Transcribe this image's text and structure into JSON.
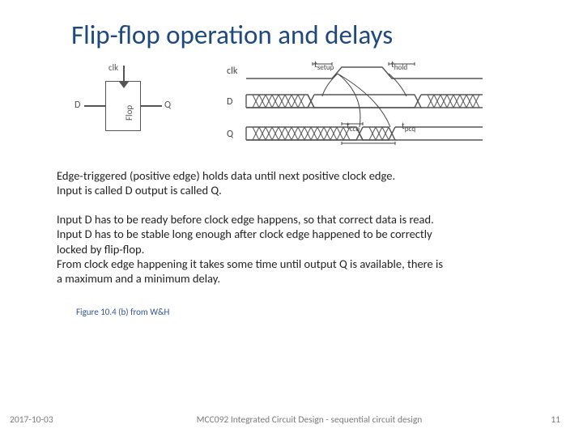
{
  "title": "Flip-flop operation and delays",
  "ff": {
    "clk": "clk",
    "flop": "Flop",
    "D": "D",
    "Q": "Q"
  },
  "timing": {
    "clk": "clk",
    "D": "D",
    "Q": "Q",
    "tsetup": "t",
    "tsetup_sub": "setup",
    "thold": "t",
    "thold_sub": "hold",
    "tccq": "t",
    "tccq_sub": "ccq",
    "tpcq": "t",
    "tpcq_sub": "pcq"
  },
  "para1_l1": "Edge-triggered (positive edge) holds data until next positive clock edge.",
  "para1_l2": "Input is called D output is called Q.",
  "para2_l1": "Input D has to be ready before clock edge happens, so that correct data is read.",
  "para2_l2": "Input D has to be stable long enough after clock edge happened to be correctly",
  "para2_l3": "locked by flip-flop.",
  "para2_l4": "From clock edge happening it takes some time until output Q is available, there is",
  "para2_l5": "a maximum and a minimum delay.",
  "figure_ref": "Figure 10.4 (b) from W&H",
  "footer": {
    "date": "2017-10-03",
    "course": "MCC092 Integrated Circuit Design - sequential circuit design",
    "page": "11"
  }
}
